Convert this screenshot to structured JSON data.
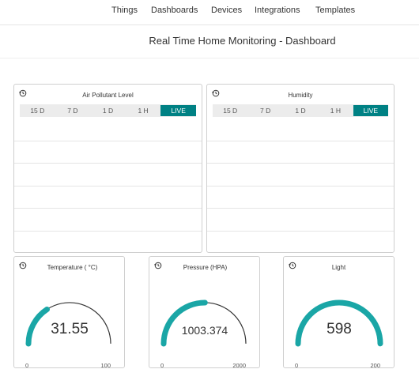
{
  "nav": {
    "items": [
      "Things",
      "Dashboards",
      "Devices",
      "Integrations",
      "Templates"
    ]
  },
  "page": {
    "title": "Real Time Home Monitoring - Dashboard"
  },
  "colors": {
    "accent": "#008184",
    "gauge_fill": "#1aa6a6",
    "gauge_track": "#333333"
  },
  "widgets": {
    "air": {
      "title": "Air Pollutant Level",
      "ranges": [
        "15 D",
        "7 D",
        "1 D",
        "1 H",
        "LIVE"
      ],
      "active_range": "LIVE"
    },
    "humidity": {
      "title": "Humidity",
      "ranges": [
        "15 D",
        "7 D",
        "1 D",
        "1 H",
        "LIVE"
      ],
      "active_range": "LIVE"
    },
    "temperature": {
      "title": "Temperature ( °C)",
      "value": "31.55",
      "min": "0",
      "max": "100",
      "fraction": 0.3155
    },
    "pressure": {
      "title": "Pressure (HPA)",
      "value": "1003.374",
      "min": "0",
      "max": "2000",
      "fraction": 0.5017
    },
    "light": {
      "title": "Light",
      "value": "598",
      "min": "0",
      "max": "200",
      "fraction": 1.0
    }
  }
}
